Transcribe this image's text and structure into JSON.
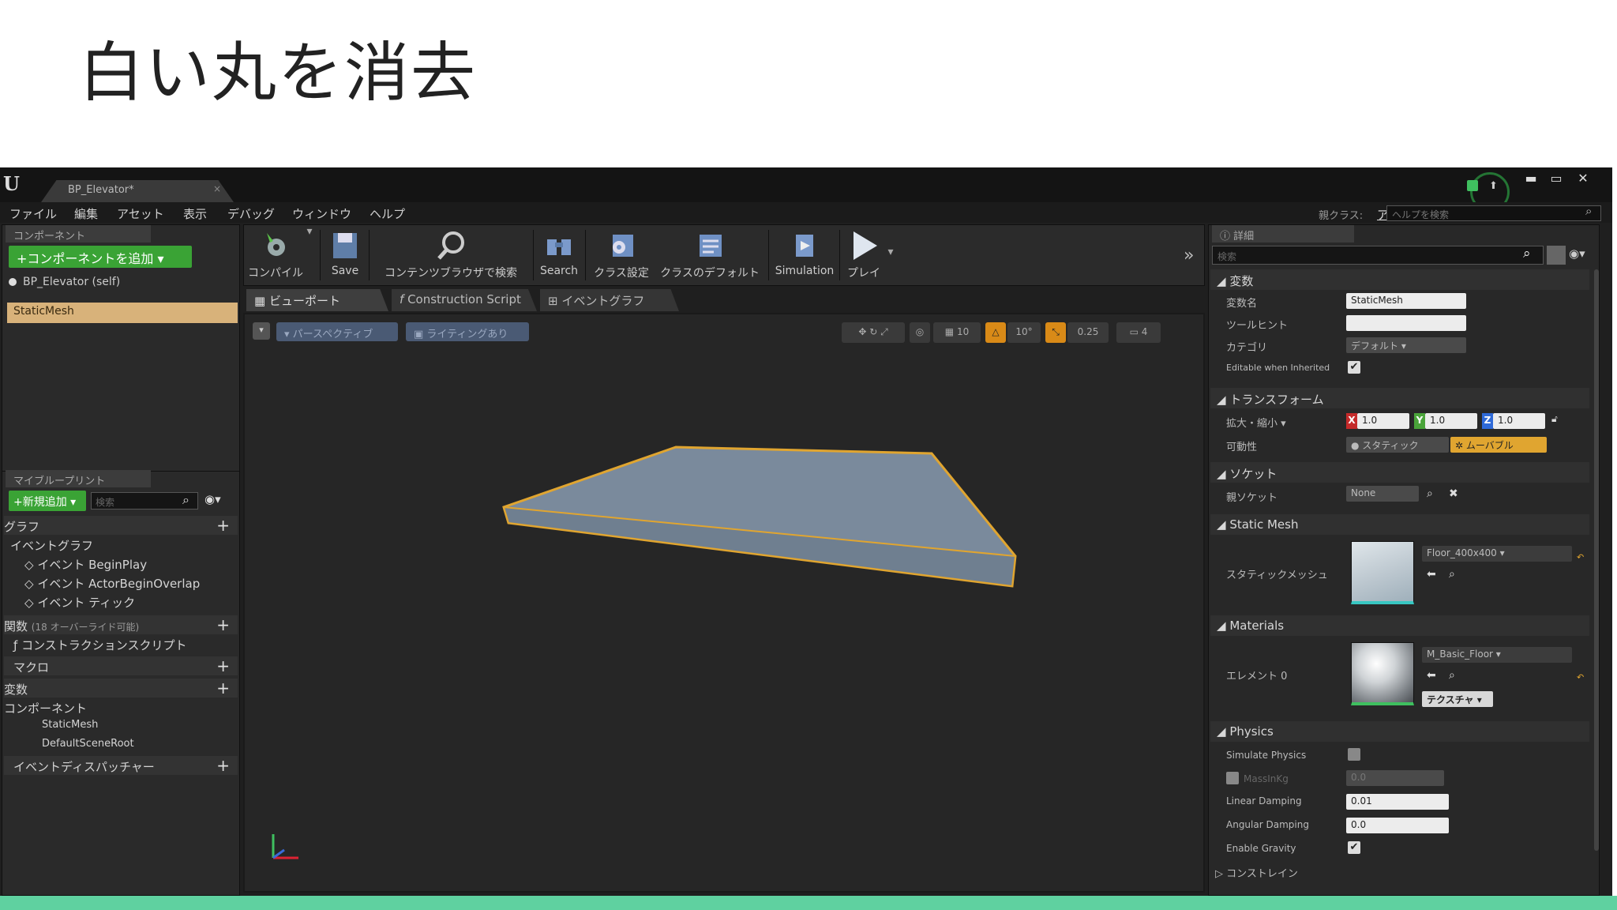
{
  "slide": {
    "title": "白い丸を消去"
  },
  "window": {
    "tab_title": "BP_Elevator*",
    "tab_close": "×",
    "minimize": "▬",
    "maximize": "▭",
    "close": "✕"
  },
  "menu": {
    "items": [
      "ファイル",
      "編集",
      "アセット",
      "表示",
      "デバッグ",
      "ウィンドウ",
      "ヘルプ"
    ],
    "parent_class_label": "親クラス:",
    "parent_class_value": "アクター",
    "help_search_placeholder": "ヘルプを検索"
  },
  "components": {
    "tab_label": "コンポーネント",
    "add_button": "+コンポーネントを追加 ▾",
    "self_label": "BP_Elevator (self)",
    "selected_item": "StaticMesh"
  },
  "my_blueprint": {
    "tab_label": "マイブループリント",
    "new_button": "+新規追加 ▾",
    "search_placeholder": "検索",
    "graph_header": "グラフ",
    "event_graph": "イベントグラフ",
    "events": [
      "イベント BeginPlay",
      "イベント ActorBeginOverlap",
      "イベント ティック"
    ],
    "functions_header": "関数",
    "functions_note": "(18 オーバーライド可能)",
    "construction_script": "コンストラクションスクリプト",
    "macros_header": "マクロ",
    "variables_header": "変数",
    "components_header": "コンポーネント",
    "component_items": [
      "StaticMesh",
      "DefaultSceneRoot"
    ],
    "dispatchers_header": "イベントディスパッチャー"
  },
  "toolbar": {
    "buttons": [
      "コンパイル",
      "Save",
      "コンテンツブラウザで検索",
      "Search",
      "クラス設定",
      "クラスのデフォルト",
      "Simulation",
      "プレイ"
    ],
    "more": "»"
  },
  "editor_tabs": [
    "ビューポート",
    "Construction Script",
    "イベントグラフ"
  ],
  "viewport": {
    "perspective": "パースペクティブ",
    "lighting": "ライティングあり",
    "grid_snap": "10",
    "rot_snap": "10°",
    "scale_snap": "0.25",
    "camera_speed": "4"
  },
  "details": {
    "tab_label": "詳細",
    "search_placeholder": "検索",
    "sections": {
      "variable": "変数",
      "transform": "トランスフォーム",
      "socket": "ソケット",
      "static_mesh": "Static Mesh",
      "materials": "Materials",
      "physics": "Physics"
    },
    "variable_name_label": "変数名",
    "variable_name_value": "StaticMesh",
    "tooltip_label": "ツールヒント",
    "tooltip_value": "",
    "category_label": "カテゴリ",
    "category_value": "デフォルト",
    "editable_inherited_label": "Editable when Inherited",
    "scale_label": "拡大・縮小 ▾",
    "scale_x": "1.0",
    "scale_y": "1.0",
    "scale_z": "1.0",
    "mobility_label": "可動性",
    "mobility_static": "スタティック",
    "mobility_movable": "ムーバブル",
    "parent_socket_label": "親ソケット",
    "parent_socket_value": "None",
    "static_mesh_label": "スタティックメッシュ",
    "static_mesh_value": "Floor_400x400",
    "element0_label": "エレメント 0",
    "element0_value": "M_Basic_Floor",
    "textures_button": "テクスチャ ▾",
    "simulate_physics_label": "Simulate Physics",
    "mass_label": "MassInKg",
    "mass_value": "0.0",
    "linear_damping_label": "Linear Damping",
    "linear_damping_value": "0.01",
    "angular_damping_label": "Angular Damping",
    "angular_damping_value": "0.0",
    "enable_gravity_label": "Enable Gravity",
    "constraints_label": "コンストレイン"
  }
}
